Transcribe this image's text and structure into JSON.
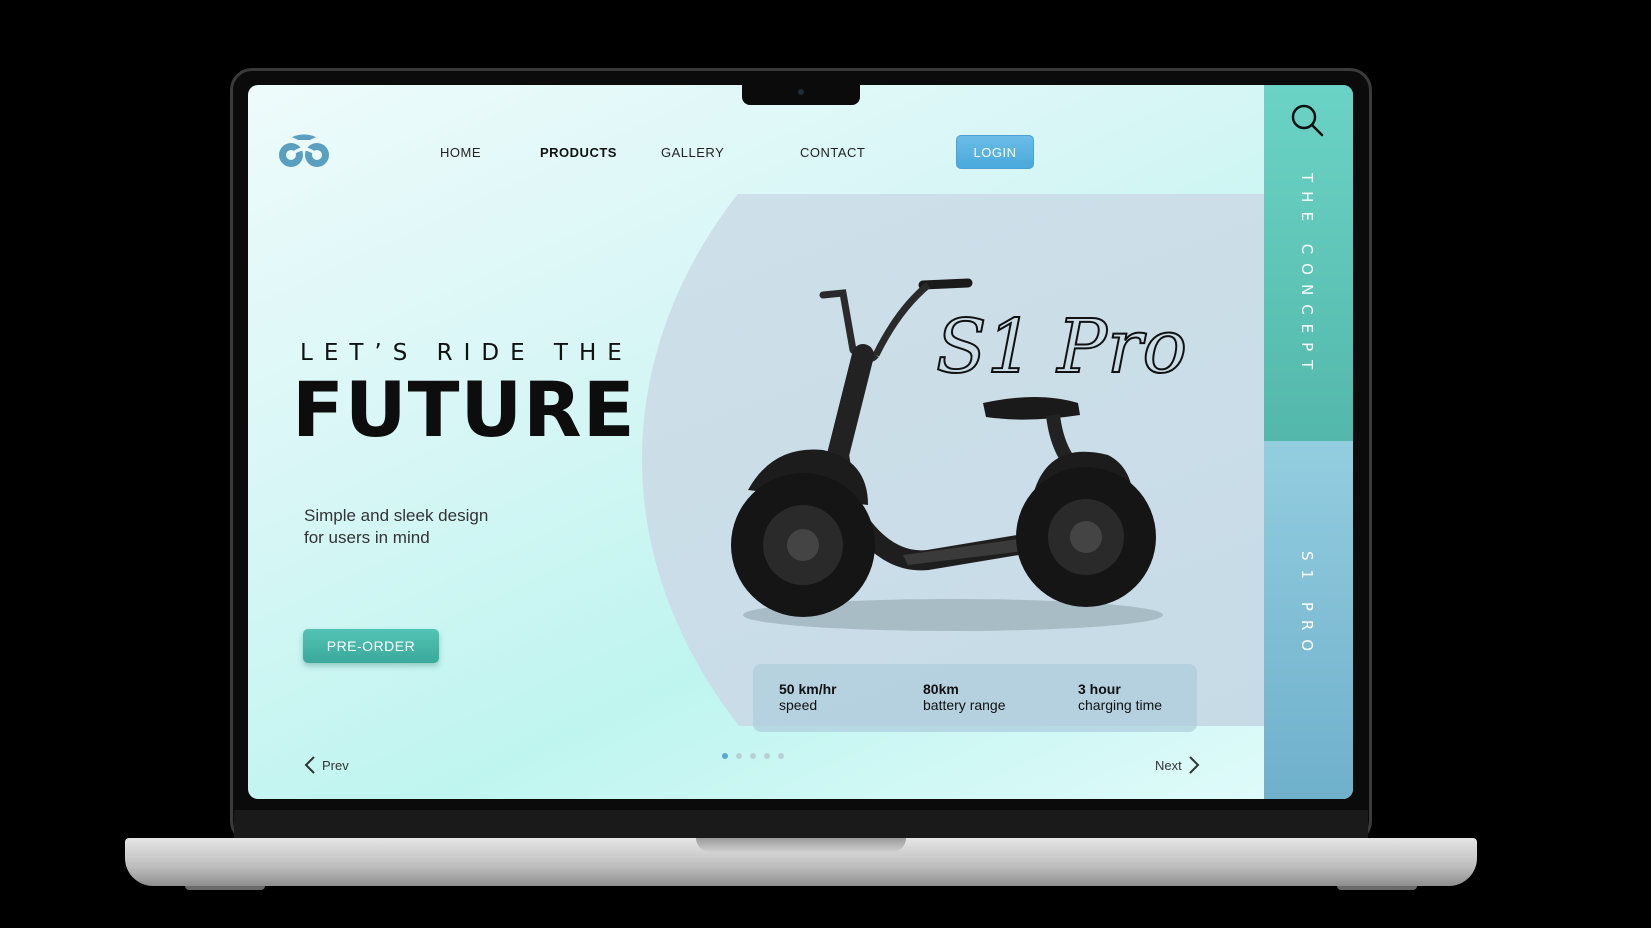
{
  "nav": {
    "items": [
      {
        "label": "HOME"
      },
      {
        "label": "PRODUCTS"
      },
      {
        "label": "GALLERY"
      },
      {
        "label": "CONTACT"
      }
    ],
    "login_label": "LOGIN"
  },
  "hero": {
    "headline_small": "LET’S RIDE THE",
    "headline_big": "FUTURE",
    "tagline_line1": "Simple and sleek design",
    "tagline_line2": "for users in mind",
    "preorder_label": "PRE-ORDER",
    "product_name": "S1 Pro"
  },
  "specs": [
    {
      "value": "50 km/hr",
      "label": "speed"
    },
    {
      "value": "80km",
      "label": "battery range"
    },
    {
      "value": "3 hour",
      "label": "charging time"
    }
  ],
  "pager": {
    "prev_label": "Prev",
    "next_label": "Next",
    "dot_count": 5,
    "active_dot": 1
  },
  "sidebar": {
    "top_label": "THE CONCEPT",
    "bottom_label": "S1 PRO"
  },
  "colors": {
    "accent_teal": "#52c3b4",
    "accent_blue": "#4aa8dc",
    "sidebar_blue": "#6fb0cb"
  },
  "icons": [
    "logo-icon",
    "search-icon",
    "chevron-left-icon",
    "chevron-right-icon"
  ]
}
